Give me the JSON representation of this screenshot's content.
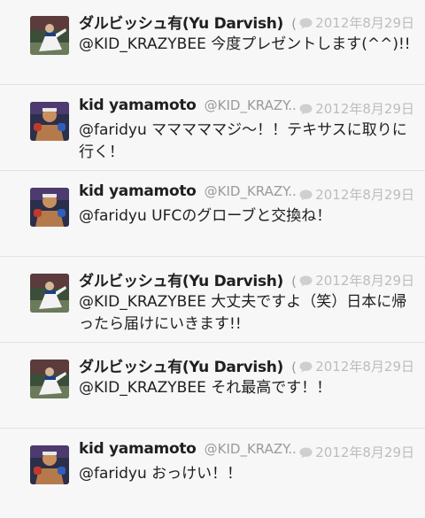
{
  "tweets": [
    {
      "name": "ダルビッシュ有(Yu Darvish)",
      "handle": "(",
      "date": "2012年8月29日",
      "text": "@KID_KRAZYBEE 今度プレゼントします(^^)!!",
      "avatar": "darvish-avatar"
    },
    {
      "name": "kid yamamoto",
      "handle": "@KID_KRAZY...",
      "date": "2012年8月29日",
      "text": "@faridyu マママママジ〜！！テキサスに取りに行く！",
      "avatar": "kid-avatar"
    },
    {
      "name": "kid yamamoto",
      "handle": "@KID_KRAZY...",
      "date": "2012年8月29日",
      "text": "@faridyu UFCのグローブと交換ね！",
      "avatar": "kid-avatar"
    },
    {
      "name": "ダルビッシュ有(Yu Darvish)",
      "handle": "(",
      "date": "2012年8月29日",
      "text": "@KID_KRAZYBEE 大丈夫ですよ（笑）日本に帰ったら届けにいきます!!",
      "avatar": "darvish-avatar"
    },
    {
      "name": "ダルビッシュ有(Yu Darvish)",
      "handle": "(",
      "date": "2012年8月29日",
      "text": "@KID_KRAZYBEE それ最高です！！",
      "avatar": "darvish-avatar"
    },
    {
      "name": "kid yamamoto",
      "handle": "@KID_KRAZY...",
      "date": "2012年8月29日",
      "text": "@faridyu おっけい！！",
      "avatar": "kid-avatar"
    }
  ]
}
